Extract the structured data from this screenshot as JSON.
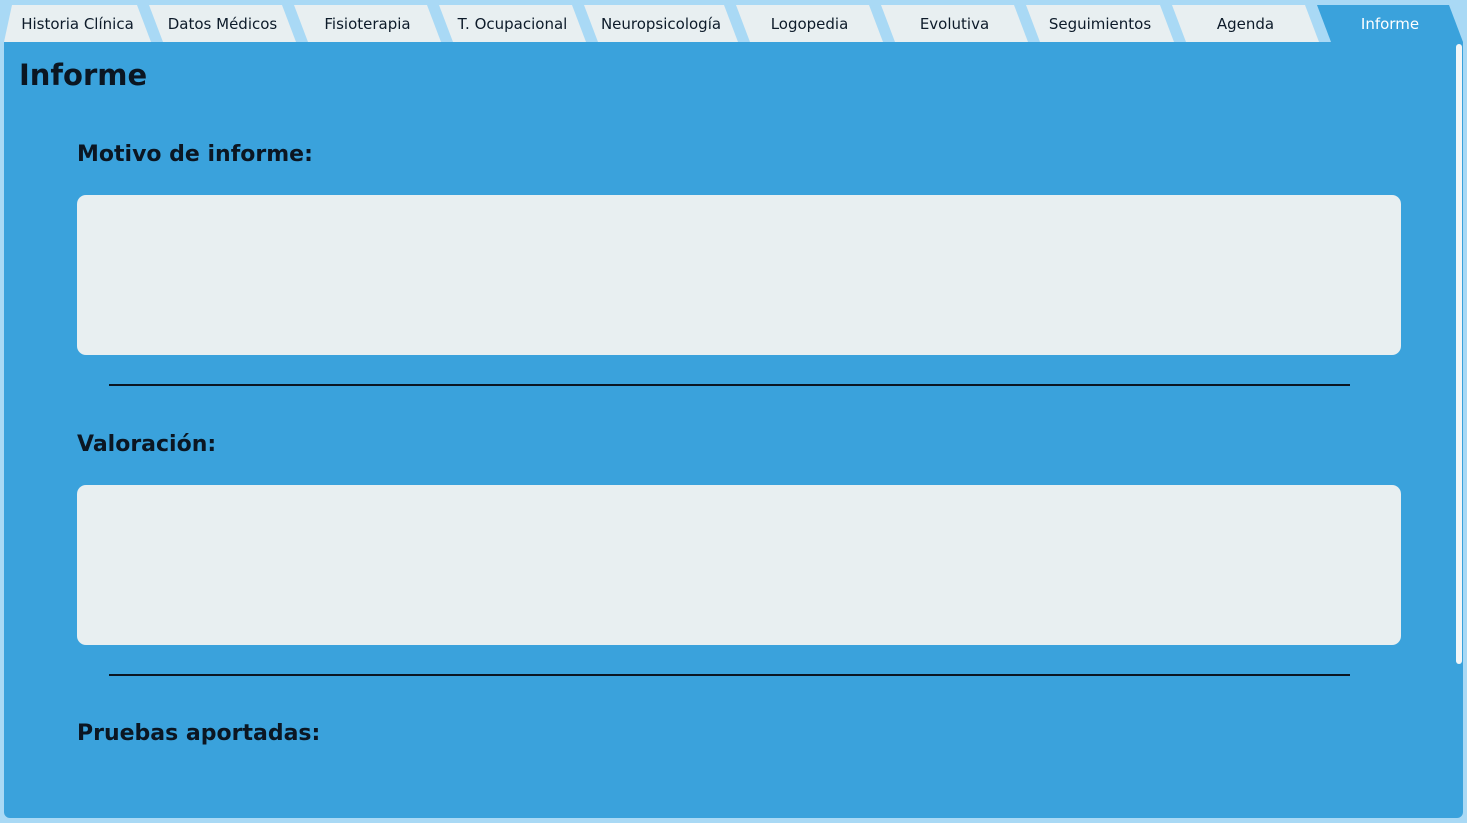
{
  "tabs": [
    {
      "label": "Historia Clínica"
    },
    {
      "label": "Datos Médicos"
    },
    {
      "label": "Fisioterapia"
    },
    {
      "label": "T. Ocupacional"
    },
    {
      "label": "Neuropsicología"
    },
    {
      "label": "Logopedia"
    },
    {
      "label": "Evolutiva"
    },
    {
      "label": "Seguimientos"
    },
    {
      "label": "Agenda"
    },
    {
      "label": "Informe"
    }
  ],
  "active_tab": "Informe",
  "page": {
    "title": "Informe"
  },
  "sections": {
    "motivo": {
      "label": "Motivo de informe:",
      "value": ""
    },
    "valoracion": {
      "label": "Valoración:",
      "value": ""
    },
    "pruebas": {
      "label": "Pruebas aportadas:"
    }
  },
  "colors": {
    "panel_background": "#3aa2dc",
    "tab_background": "#e8eff1",
    "page_background": "#a9d9f5",
    "text": "#0b1622"
  }
}
